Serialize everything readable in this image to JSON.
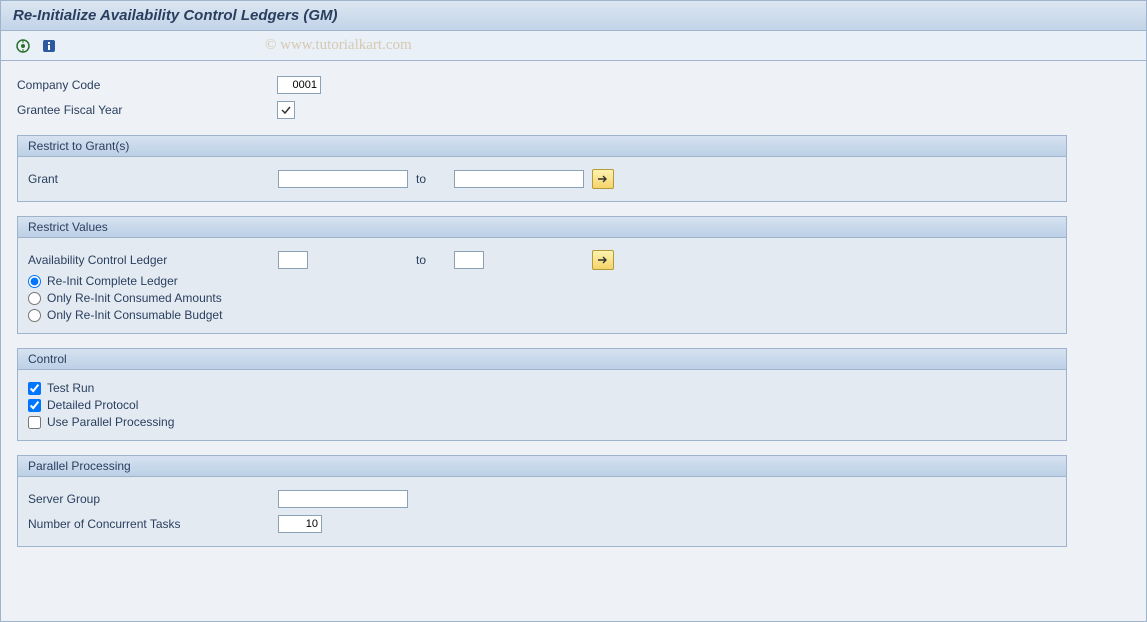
{
  "title": "Re-Initialize Availability Control Ledgers (GM)",
  "watermark": "© www.tutorialkart.com",
  "header": {
    "company_code_label": "Company Code",
    "company_code_value": "0001",
    "fiscal_year_label": "Grantee Fiscal Year",
    "fiscal_year_checked": true
  },
  "restrict_grants": {
    "title": "Restrict to Grant(s)",
    "grant_label": "Grant",
    "grant_from": "",
    "grant_to": "",
    "to_label": "to"
  },
  "restrict_values": {
    "title": "Restrict Values",
    "ledger_label": "Availability Control Ledger",
    "ledger_from": "",
    "ledger_to": "",
    "to_label": "to",
    "radio_options": [
      {
        "label": "Re-Init Complete Ledger",
        "checked": true
      },
      {
        "label": "Only Re-Init Consumed Amounts",
        "checked": false
      },
      {
        "label": "Only Re-Init Consumable Budget",
        "checked": false
      }
    ]
  },
  "control": {
    "title": "Control",
    "test_run_label": "Test Run",
    "test_run_checked": true,
    "detailed_protocol_label": "Detailed Protocol",
    "detailed_protocol_checked": true,
    "parallel_label": "Use Parallel Processing",
    "parallel_checked": false
  },
  "parallel": {
    "title": "Parallel Processing",
    "server_group_label": "Server Group",
    "server_group_value": "",
    "tasks_label": "Number of Concurrent Tasks",
    "tasks_value": "10"
  }
}
